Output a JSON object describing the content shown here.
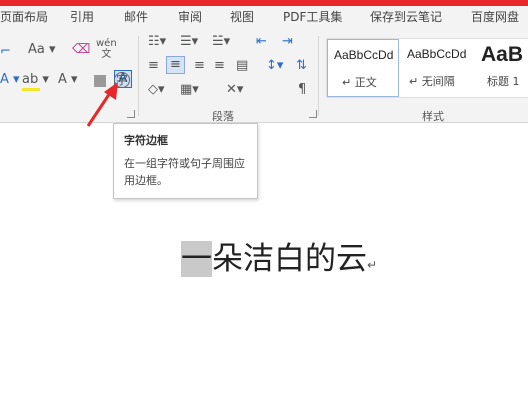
{
  "tabs": [
    "页面布局",
    "引用",
    "邮件",
    "审阅",
    "视图",
    "PDF工具集",
    "保存到云笔记",
    "百度网盘"
  ],
  "ribbon": {
    "font_group": {
      "font_size_aa": "Aa",
      "phonetic_top": "wén",
      "phonetic_bottom": "文",
      "char_border_label": "A",
      "enclose_char": "字"
    },
    "paragraph_label": "段落",
    "styles_label": "样式",
    "styles": [
      {
        "sample": "AaBbCcDd",
        "name": "正文"
      },
      {
        "sample": "AaBbCcDd",
        "name": "无间隔"
      },
      {
        "sample": "AaB",
        "name": "标题 1"
      }
    ]
  },
  "tooltip": {
    "title": "字符边框",
    "description": "在一组字符或句子周围应用边框。"
  },
  "document": {
    "selected_text": "一",
    "rest_text": "朵洁白的云",
    "paragraph_mark": "↵"
  },
  "colors": {
    "title_bar": "#e8272a",
    "ribbon_bg": "#f3f3f3",
    "arrow": "#e8272a",
    "selection": "#c9c9c9"
  }
}
